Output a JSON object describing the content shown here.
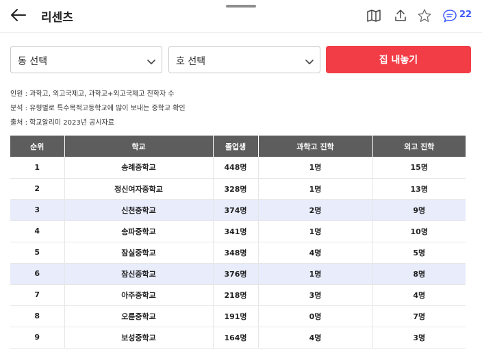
{
  "header": {
    "title": "리센츠",
    "comment_count": "22",
    "icons": [
      "back-arrow-icon",
      "map-icon",
      "share-icon",
      "star-icon",
      "comment-icon"
    ]
  },
  "filters": {
    "dong_label": "동 선택",
    "ho_label": "호 선택",
    "sell_button_label": "집 내놓기",
    "accent_color": "#f23d46"
  },
  "notes": [
    "인원 : 과학고, 외고국제고, 과학고+외고국제고 진학자 수",
    "분석 : 유형별로 특수목적고등학교에 많이 보내는 중학교 확인",
    "출처 : 학교알리미 2023년 공시자료"
  ],
  "table": {
    "headers": [
      "순위",
      "학교",
      "졸업생",
      "과학고 진학",
      "외고 진학"
    ],
    "rows": [
      {
        "rank": "1",
        "school": "송례중학교",
        "graduates": "448명",
        "science": "1명",
        "foreign": "15명",
        "highlight": false
      },
      {
        "rank": "2",
        "school": "정신여자중학교",
        "graduates": "328명",
        "science": "1명",
        "foreign": "13명",
        "highlight": false
      },
      {
        "rank": "3",
        "school": "신천중학교",
        "graduates": "374명",
        "science": "2명",
        "foreign": "9명",
        "highlight": true
      },
      {
        "rank": "4",
        "school": "송파중학교",
        "graduates": "341명",
        "science": "1명",
        "foreign": "10명",
        "highlight": false
      },
      {
        "rank": "5",
        "school": "잠실중학교",
        "graduates": "348명",
        "science": "4명",
        "foreign": "5명",
        "highlight": false
      },
      {
        "rank": "6",
        "school": "잠신중학교",
        "graduates": "376명",
        "science": "1명",
        "foreign": "8명",
        "highlight": true
      },
      {
        "rank": "7",
        "school": "아주중학교",
        "graduates": "218명",
        "science": "3명",
        "foreign": "4명",
        "highlight": false
      },
      {
        "rank": "8",
        "school": "오륜중학교",
        "graduates": "191명",
        "science": "0명",
        "foreign": "7명",
        "highlight": false
      },
      {
        "rank": "9",
        "school": "보성중학교",
        "graduates": "164명",
        "science": "4명",
        "foreign": "3명",
        "highlight": false
      }
    ]
  }
}
